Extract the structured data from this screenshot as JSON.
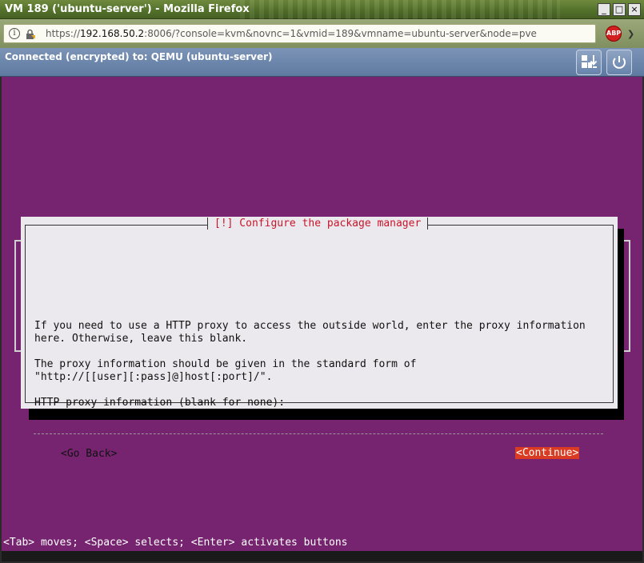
{
  "window": {
    "title": "VM 189 ('ubuntu-server') - Mozilla Firefox",
    "buttons": {
      "minimize": "_",
      "maximize": "□",
      "close": "×"
    }
  },
  "browser": {
    "url_prefix": "https://",
    "url_host": "192.168.50.2",
    "url_rest": ":8006/?console=kvm&novnc=1&vmid=189&vmname=ubuntu-server&node=pve",
    "info_icon": "i",
    "abp_label": "ABP",
    "menu_chevron": "❯"
  },
  "vnc": {
    "status": "Connected (encrypted) to: QEMU (ubuntu-server)"
  },
  "installer": {
    "title": "[!] Configure the package manager",
    "paragraph1": [
      "If you need to use a HTTP proxy to access the outside world, enter the proxy information",
      "here. Otherwise, leave this blank."
    ],
    "paragraph2": [
      "The proxy information should be given in the standard form of",
      "\"http://[[user][:pass]@]host[:port]/\"."
    ],
    "field_label": "HTTP proxy information (blank for none):",
    "field_value": "",
    "go_back": "<Go Back>",
    "continue": "<Continue>",
    "help": "<Tab> moves; <Space> selects; <Enter> activates buttons"
  },
  "colors": {
    "console_bg": "#772470",
    "dialog_bg": "#ebe9ed",
    "title_red": "#c7162b",
    "continue_bg": "#d93c22"
  }
}
